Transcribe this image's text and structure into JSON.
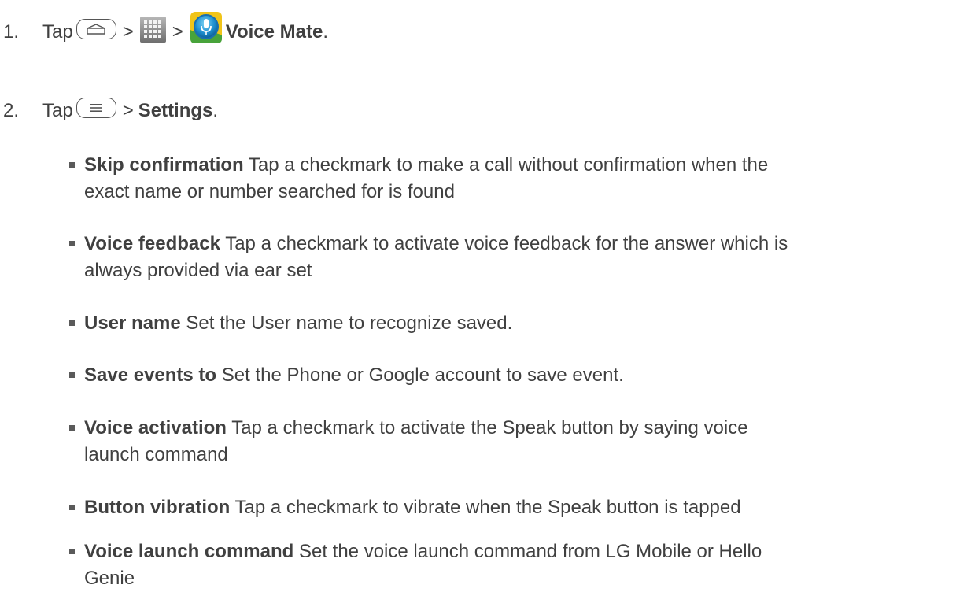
{
  "steps": [
    {
      "number": "1.",
      "tap": "Tap",
      "sep": ">",
      "app_name": "Voice Mate",
      "period": "."
    },
    {
      "number": "2.",
      "tap": "Tap",
      "sep": ">",
      "target": "Settings",
      "period": "."
    }
  ],
  "icons": {
    "home_key": "home-key-icon",
    "apps": "apps-grid-icon",
    "voice_mate": "voice-mate-icon",
    "menu_key": "menu-key-icon"
  },
  "settings": [
    {
      "name": "Skip confirmation",
      "desc": "Tap a checkmark to make a call without confirmation when the",
      "desc2": "exact name or number searched for is found"
    },
    {
      "name": "Voice feedback",
      "desc": "Tap a checkmark to activate voice feedback for the answer which is",
      "desc2": "always provided via ear set"
    },
    {
      "name": "User name",
      "desc": "Set the User name to recognize saved.",
      "desc2": ""
    },
    {
      "name": "Save events to",
      "desc": "Set the Phone or Google account to save event.",
      "desc2": ""
    },
    {
      "name": "Voice activation",
      "desc": "Tap a checkmark to activate the Speak button by saying voice",
      "desc2": "launch command"
    },
    {
      "name": "Button vibration",
      "desc": "Tap a checkmark to vibrate when the Speak button is tapped",
      "desc2": ""
    },
    {
      "name": "Voice launch command",
      "desc": "Set the voice launch command from LG Mobile or Hello",
      "desc2": "Genie"
    }
  ]
}
